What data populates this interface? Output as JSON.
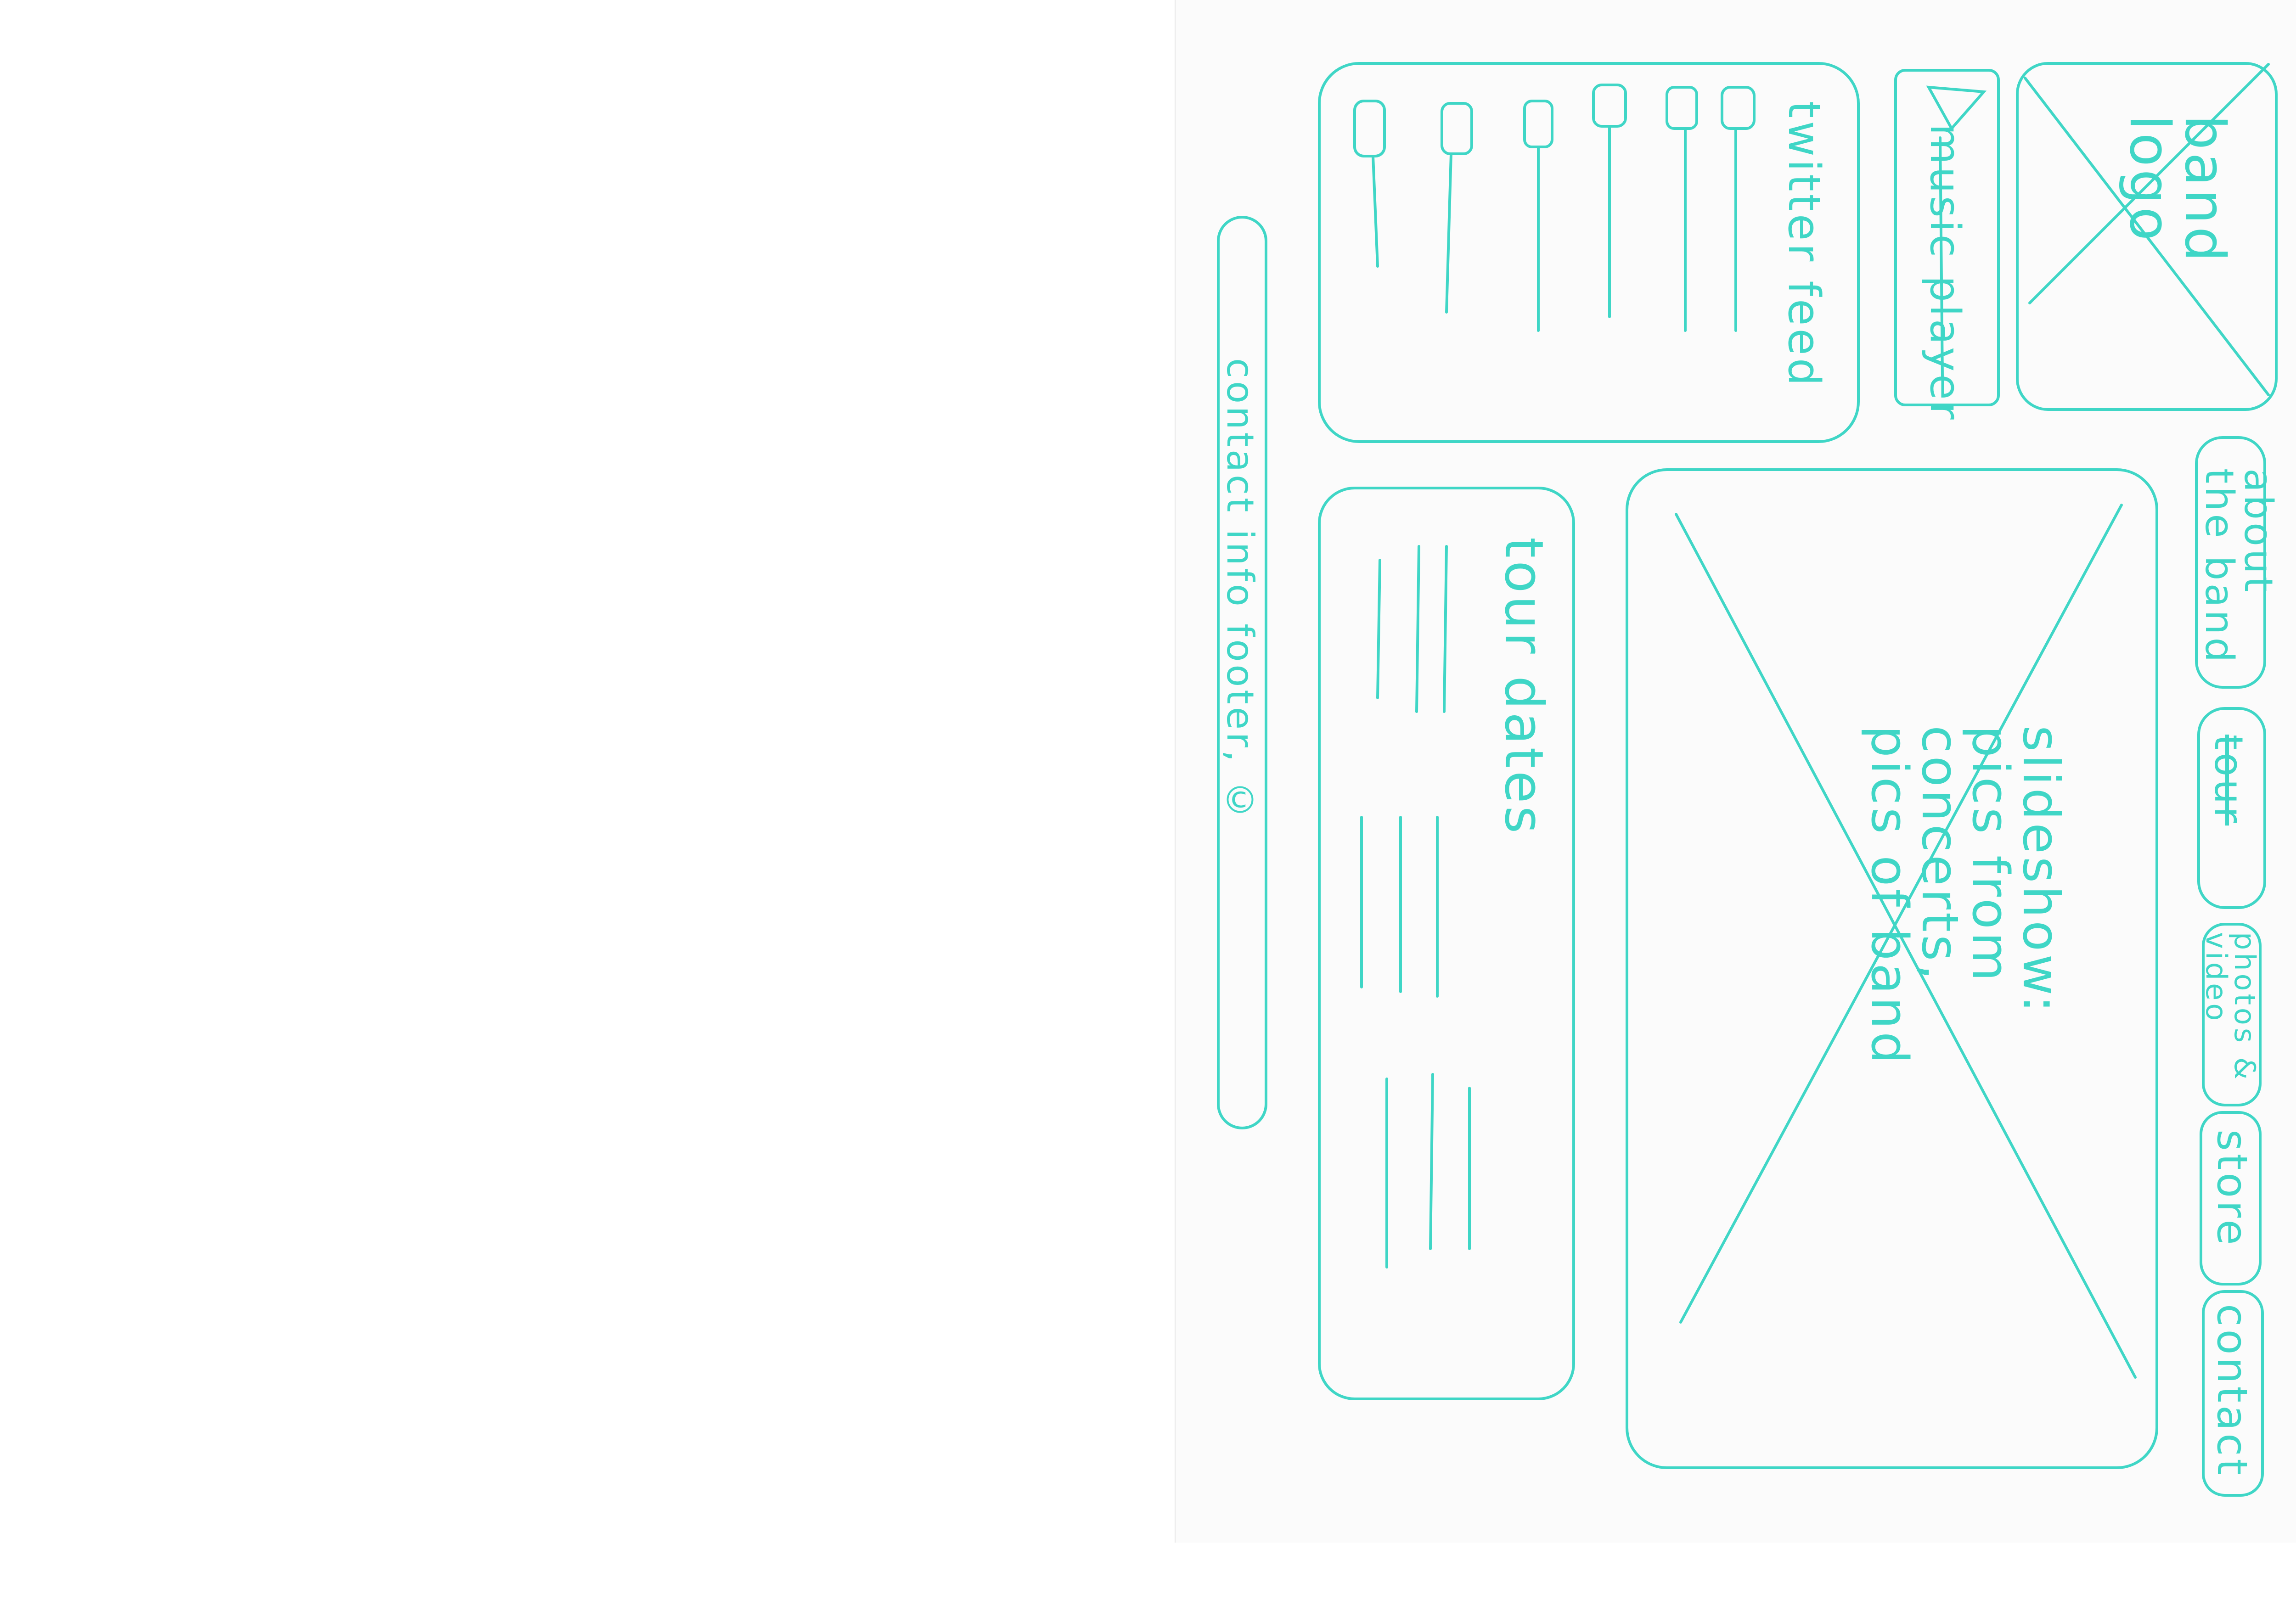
{
  "header": {
    "logo_text": "band\nlogo",
    "music_player": "music player"
  },
  "nav": {
    "items": [
      "about the band",
      "tour",
      "photos & video",
      "store",
      "contact"
    ]
  },
  "slideshow": {
    "label": "slideshow:\npics from\nconcerts,\npics of band"
  },
  "twitter_feed": {
    "label": "twitter feed"
  },
  "tour_dates": {
    "label": "tour dates"
  },
  "footer": {
    "label": "contact info footer, ©"
  },
  "colors": {
    "ink": "#3fd6c6",
    "paper": "#fbfbfb"
  }
}
